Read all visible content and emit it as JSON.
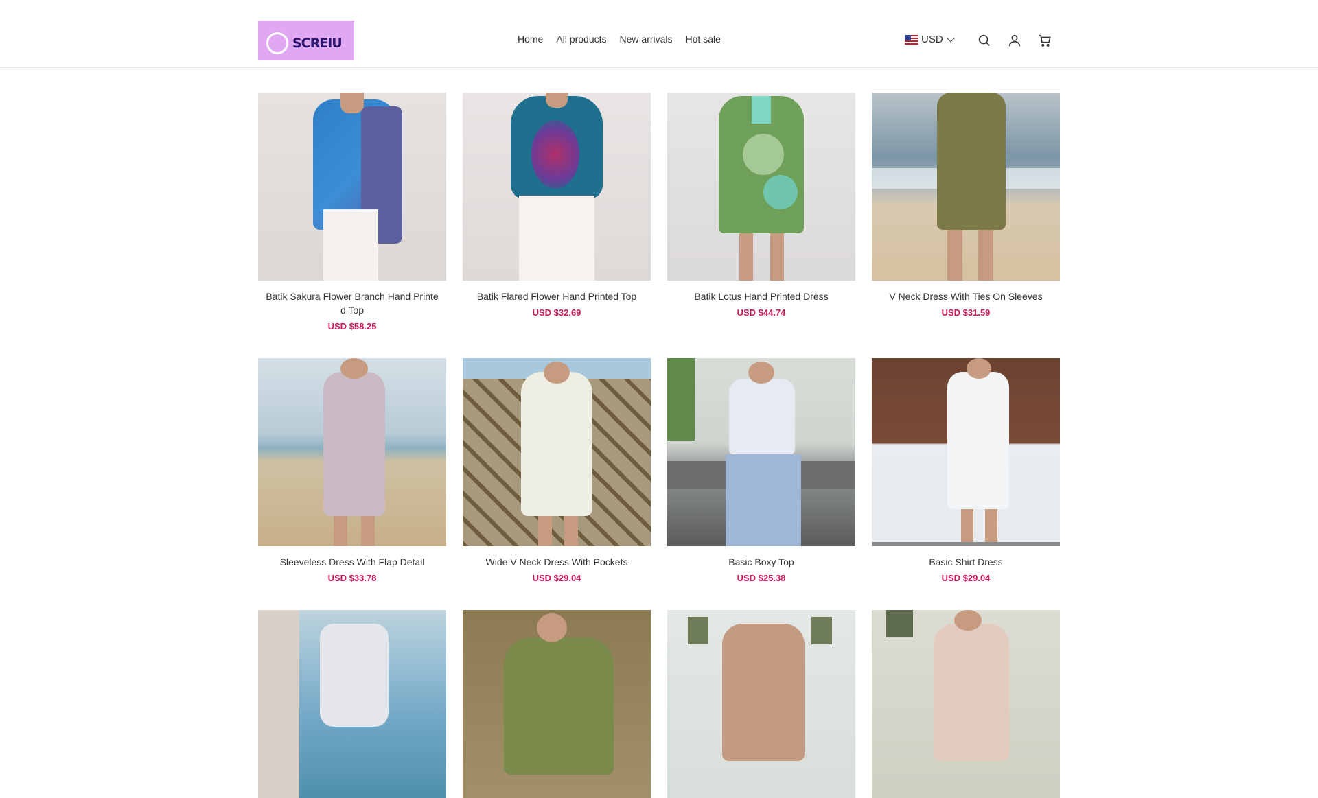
{
  "logo": {
    "text": "SCREIU"
  },
  "nav": {
    "items": [
      "Home",
      "All products",
      "New arrivals",
      "Hot sale"
    ]
  },
  "currency": {
    "label": "USD"
  },
  "icons": [
    "search-icon",
    "user-icon",
    "cart-icon"
  ],
  "colors": {
    "price": "#c8195c",
    "logo_bg": "#e0a8f0"
  },
  "products": [
    {
      "title": "Batik Sakura Flower Branch Hand Printe d Top",
      "price": "USD $58.25"
    },
    {
      "title": "Batik Flared Flower Hand Printed Top",
      "price": "USD $32.69"
    },
    {
      "title": "Batik Lotus Hand Printed Dress",
      "price": "USD $44.74"
    },
    {
      "title": "V Neck Dress With Ties On Sleeves",
      "price": "USD $31.59"
    },
    {
      "title": "Sleeveless Dress With Flap Detail",
      "price": "USD $33.78"
    },
    {
      "title": "Wide V Neck Dress With Pockets",
      "price": "USD $29.04"
    },
    {
      "title": "Basic Boxy Top",
      "price": "USD $25.38"
    },
    {
      "title": "Basic Shirt Dress",
      "price": "USD $29.04"
    },
    {
      "title": "",
      "price": ""
    },
    {
      "title": "",
      "price": ""
    },
    {
      "title": "",
      "price": ""
    },
    {
      "title": "",
      "price": ""
    }
  ]
}
